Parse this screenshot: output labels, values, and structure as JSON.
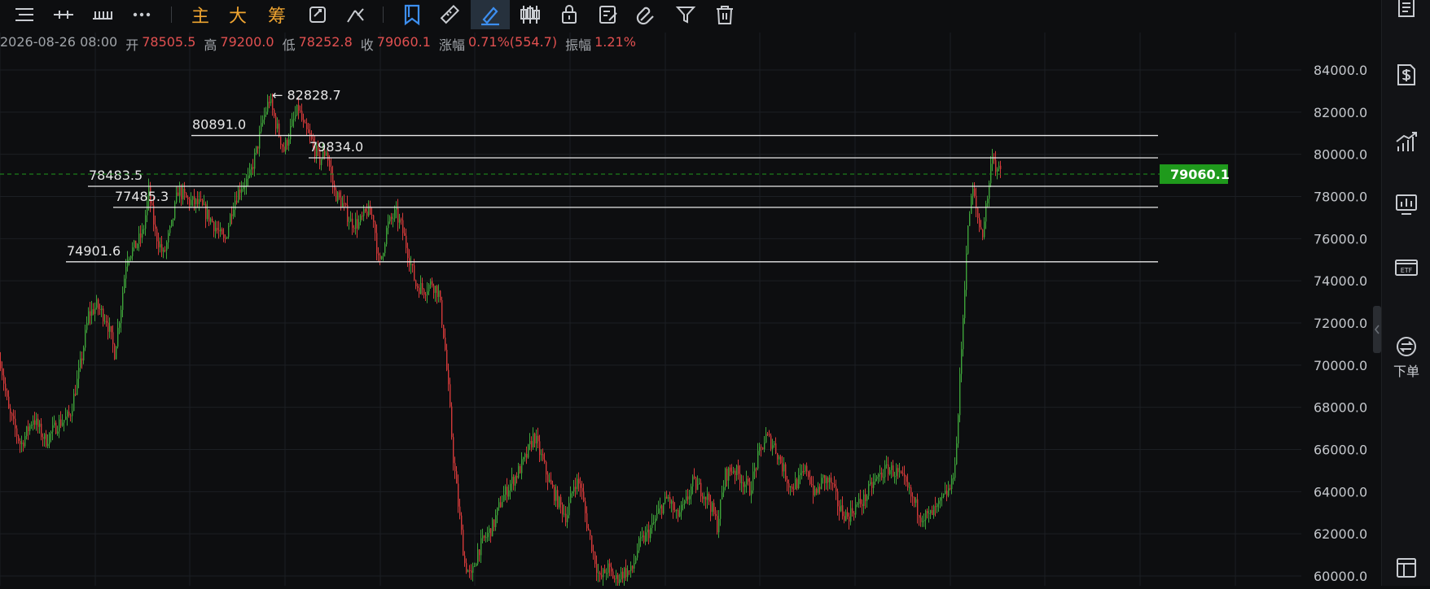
{
  "toolbar": {
    "items": [
      {
        "name": "menu-icon",
        "type": "icon"
      },
      {
        "name": "crosshair-line-icon",
        "type": "icon"
      },
      {
        "name": "ruler-bars-icon",
        "type": "icon"
      },
      {
        "name": "more-icon",
        "type": "icon"
      },
      {
        "name": "indicator-main",
        "type": "text",
        "label": "主"
      },
      {
        "name": "indicator-big",
        "type": "text",
        "label": "大"
      },
      {
        "name": "indicator-chips",
        "type": "text",
        "label": "筹"
      },
      {
        "name": "refresh-edit-icon",
        "type": "icon"
      },
      {
        "name": "draw-tools-icon",
        "type": "icon"
      },
      {
        "name": "bookmark-icon",
        "type": "icon"
      },
      {
        "name": "ruler-icon",
        "type": "icon"
      },
      {
        "name": "pen-icon",
        "type": "icon",
        "active": true
      },
      {
        "name": "candles-icon",
        "type": "icon"
      },
      {
        "name": "lock-icon",
        "type": "icon"
      },
      {
        "name": "note-icon",
        "type": "icon"
      },
      {
        "name": "magnet-icon",
        "type": "icon"
      },
      {
        "name": "filter-icon",
        "type": "icon"
      },
      {
        "name": "trash-icon",
        "type": "icon"
      }
    ]
  },
  "ohlc": {
    "datetime": "2026-08-26 08:00",
    "open_label": "开",
    "open": "78505.5",
    "high_label": "高",
    "high": "79200.0",
    "low_label": "低",
    "low": "78252.8",
    "close_label": "收",
    "close": "79060.1",
    "change_label": "涨幅",
    "change": "0.71%(554.7)",
    "amp_label": "振幅",
    "amp": "1.21%"
  },
  "chart_data": {
    "type": "candlestick",
    "y_ticks": [
      "84000.0",
      "82000.0",
      "80000.0",
      "78000.0",
      "76000.0",
      "74000.0",
      "72000.0",
      "70000.0",
      "68000.0",
      "66000.0",
      "64000.0",
      "62000.0",
      "60000.0"
    ],
    "ylim": [
      59600,
      85000
    ],
    "current_price": "79060.1",
    "max_marker": "← 82828.7",
    "horizontal_levels": [
      {
        "label": "80891.0",
        "price": 80891.0
      },
      {
        "label": "79834.0",
        "price": 79834.0
      },
      {
        "label": "78483.5",
        "price": 78483.5
      },
      {
        "label": "77485.3",
        "price": 77485.3
      },
      {
        "label": "74901.6",
        "price": 74901.6
      }
    ],
    "path_points": [
      [
        0,
        70200
      ],
      [
        10,
        67800
      ],
      [
        25,
        66200
      ],
      [
        40,
        67500
      ],
      [
        55,
        66400
      ],
      [
        70,
        67200
      ],
      [
        85,
        67600
      ],
      [
        95,
        69400
      ],
      [
        100,
        70400
      ],
      [
        108,
        72400
      ],
      [
        118,
        72800
      ],
      [
        130,
        72200
      ],
      [
        140,
        70600
      ],
      [
        148,
        72800
      ],
      [
        155,
        75200
      ],
      [
        165,
        75600
      ],
      [
        175,
        76300
      ],
      [
        182,
        78200
      ],
      [
        190,
        76300
      ],
      [
        200,
        75200
      ],
      [
        210,
        76600
      ],
      [
        218,
        78300
      ],
      [
        230,
        77800
      ],
      [
        245,
        77600
      ],
      [
        260,
        76800
      ],
      [
        275,
        75800
      ],
      [
        285,
        77600
      ],
      [
        295,
        78500
      ],
      [
        305,
        78800
      ],
      [
        315,
        80300
      ],
      [
        322,
        81600
      ],
      [
        330,
        82600
      ],
      [
        340,
        81200
      ],
      [
        348,
        80200
      ],
      [
        358,
        81400
      ],
      [
        366,
        82200
      ],
      [
        372,
        81300
      ],
      [
        382,
        80600
      ],
      [
        392,
        79700
      ],
      [
        400,
        80200
      ],
      [
        410,
        78200
      ],
      [
        420,
        77600
      ],
      [
        430,
        76800
      ],
      [
        440,
        76700
      ],
      [
        450,
        77300
      ],
      [
        458,
        77000
      ],
      [
        465,
        74600
      ],
      [
        475,
        76600
      ],
      [
        485,
        77200
      ],
      [
        492,
        76600
      ],
      [
        500,
        75400
      ],
      [
        510,
        73800
      ],
      [
        520,
        73600
      ],
      [
        530,
        73900
      ],
      [
        538,
        73400
      ],
      [
        545,
        71200
      ],
      [
        550,
        68800
      ],
      [
        556,
        65600
      ],
      [
        562,
        63400
      ],
      [
        570,
        60600
      ],
      [
        578,
        59900
      ],
      [
        586,
        61200
      ],
      [
        595,
        61800
      ],
      [
        605,
        62400
      ],
      [
        615,
        63600
      ],
      [
        625,
        64300
      ],
      [
        635,
        64900
      ],
      [
        645,
        65600
      ],
      [
        655,
        66700
      ],
      [
        665,
        65500
      ],
      [
        675,
        64300
      ],
      [
        685,
        63500
      ],
      [
        695,
        62800
      ],
      [
        705,
        64500
      ],
      [
        712,
        64300
      ],
      [
        720,
        62500
      ],
      [
        728,
        61100
      ],
      [
        736,
        59800
      ],
      [
        745,
        60400
      ],
      [
        755,
        59800
      ],
      [
        765,
        60200
      ],
      [
        775,
        60200
      ],
      [
        783,
        61400
      ],
      [
        790,
        61800
      ],
      [
        800,
        62300
      ],
      [
        810,
        63200
      ],
      [
        820,
        63700
      ],
      [
        830,
        62800
      ],
      [
        840,
        63300
      ],
      [
        850,
        64400
      ],
      [
        860,
        64100
      ],
      [
        870,
        63600
      ],
      [
        880,
        62400
      ],
      [
        890,
        64800
      ],
      [
        900,
        65100
      ],
      [
        910,
        64600
      ],
      [
        920,
        64100
      ],
      [
        930,
        65600
      ],
      [
        940,
        66600
      ],
      [
        950,
        66200
      ],
      [
        960,
        65200
      ],
      [
        970,
        64200
      ],
      [
        980,
        64500
      ],
      [
        990,
        65100
      ],
      [
        1000,
        63800
      ],
      [
        1010,
        64600
      ],
      [
        1020,
        64400
      ],
      [
        1030,
        63200
      ],
      [
        1040,
        62800
      ],
      [
        1050,
        63300
      ],
      [
        1060,
        63600
      ],
      [
        1070,
        64300
      ],
      [
        1080,
        64800
      ],
      [
        1090,
        65100
      ],
      [
        1100,
        64900
      ],
      [
        1110,
        64400
      ],
      [
        1120,
        63600
      ],
      [
        1130,
        62900
      ],
      [
        1140,
        62800
      ],
      [
        1150,
        63200
      ],
      [
        1160,
        63800
      ],
      [
        1168,
        64300
      ],
      [
        1174,
        66200
      ],
      [
        1178,
        69300
      ],
      [
        1182,
        72300
      ],
      [
        1186,
        75400
      ],
      [
        1190,
        77300
      ],
      [
        1194,
        78300
      ],
      [
        1198,
        77400
      ],
      [
        1202,
        76600
      ],
      [
        1206,
        76300
      ],
      [
        1210,
        77500
      ],
      [
        1214,
        78600
      ],
      [
        1218,
        80200
      ],
      [
        1222,
        79400
      ],
      [
        1228,
        79060
      ]
    ]
  },
  "sidebar": {
    "items": [
      {
        "name": "notes-doc-icon",
        "label": ""
      },
      {
        "name": "dollar-doc-icon",
        "label": ""
      },
      {
        "name": "trend-chart-icon",
        "label": ""
      },
      {
        "name": "monitor-chart-icon",
        "label": ""
      },
      {
        "name": "etf-icon",
        "label": ""
      },
      {
        "name": "order-swap-icon",
        "label": "下单"
      },
      {
        "name": "layout-icon",
        "label": ""
      }
    ]
  },
  "colors": {
    "up": "#3ea33a",
    "down": "#d43a3a",
    "grid": "#1c1f23",
    "level": "#e8e8e8",
    "current": "#1f9a1c",
    "axis_text": "#c4c7cc"
  }
}
